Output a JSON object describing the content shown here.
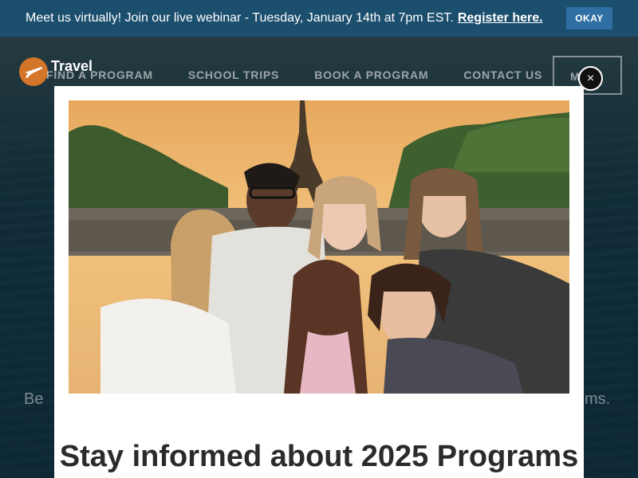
{
  "banner": {
    "text": "Meet us virtually! Join our live webinar - Tuesday, January 14th at 7pm EST.",
    "link_label": "Register here.",
    "okay_label": "OKAY"
  },
  "header": {
    "logo_text": "Travel",
    "nav": [
      "FIND A PROGRAM",
      "SCHOOL TRIPS",
      "BOOK A PROGRAM",
      "CONTACT US"
    ],
    "more_label": "M"
  },
  "hero": {
    "left_fragment": "Be",
    "right_fragment": "ms."
  },
  "modal": {
    "close_label": "×",
    "title": "Stay informed about 2025 Programs",
    "photo_subject": "students-in-front-of-eiffel-tower"
  },
  "colors": {
    "banner_bg": "#1c4f6e",
    "okay_bg": "#2f6fa3",
    "logo_accent": "#d4762a",
    "title_text": "#2b2b2b"
  }
}
